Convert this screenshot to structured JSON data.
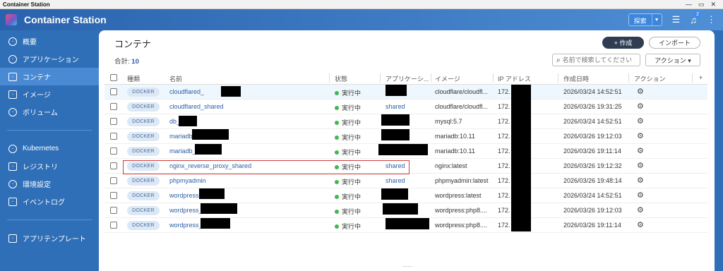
{
  "window": {
    "title": "Container Station"
  },
  "app": {
    "name": "Container Station",
    "search_label": "探索",
    "notif_count": "2"
  },
  "sidebar": {
    "groups": [
      [
        {
          "label": "概要",
          "icon": "dashboard-icon"
        },
        {
          "label": "アプリケーション",
          "icon": "apps-icon"
        },
        {
          "label": "コンテナ",
          "icon": "cube-icon",
          "active": true
        },
        {
          "label": "イメージ",
          "icon": "layers-icon"
        },
        {
          "label": "ボリューム",
          "icon": "database-icon"
        }
      ],
      [
        {
          "label": "Kubernetes",
          "icon": "kubernetes-icon"
        },
        {
          "label": "レジストリ",
          "icon": "registry-icon"
        },
        {
          "label": "環境設定",
          "icon": "gear-icon"
        },
        {
          "label": "イベントログ",
          "icon": "log-icon"
        }
      ],
      [
        {
          "label": "アプリテンプレート",
          "icon": "template-icon"
        }
      ]
    ]
  },
  "main": {
    "title": "コンテナ",
    "total_label": "合計:",
    "total_count": "10",
    "create_label": "+ 作成",
    "import_label": "インポート",
    "search_placeholder": "名前で検索してください",
    "action_label": "アクション ▾"
  },
  "table": {
    "headers": {
      "type": "種類",
      "name": "名前",
      "status": "状態",
      "app": "アプリケーシ...",
      "image": "イメージ",
      "ip": "IP アドレス",
      "created": "作成日時",
      "action": "アクション",
      "add": "+"
    },
    "rows": [
      {
        "type": "DOCKER",
        "name": "cloudflared_",
        "status": "実行中",
        "app": "",
        "image": "cloudflare/cloudfl...",
        "ip": "172.",
        "created": "2026/03/24 14:52:51"
      },
      {
        "type": "DOCKER",
        "name": "cloudflared_shared",
        "status": "実行中",
        "app": "shared",
        "image": "cloudflare/cloudfl...",
        "ip": "172.",
        "created": "2026/03/26 19:31:25"
      },
      {
        "type": "DOCKER",
        "name": "db_",
        "status": "実行中",
        "app": "",
        "image": "mysql:5.7",
        "ip": "172.",
        "created": "2026/03/24 14:52:51"
      },
      {
        "type": "DOCKER",
        "name": "mariadb",
        "status": "実行中",
        "app": "",
        "image": "mariadb:10.11",
        "ip": "172.",
        "created": "2026/03/26 19:12:03"
      },
      {
        "type": "DOCKER",
        "name": "mariadb_",
        "status": "実行中",
        "app": "",
        "image": "mariadb:10.11",
        "ip": "172.",
        "created": "2026/03/26 19:11:14"
      },
      {
        "type": "DOCKER",
        "name": "nginx_reverse_proxy_shared",
        "status": "実行中",
        "app": "shared",
        "image": "nginx:latest",
        "ip": "172.",
        "created": "2026/03/26 19:12:32"
      },
      {
        "type": "DOCKER",
        "name": "phpmyadmin",
        "status": "実行中",
        "app": "shared",
        "image": "phpmyadmin:latest",
        "ip": "172.",
        "created": "2026/03/26 19:48:14"
      },
      {
        "type": "DOCKER",
        "name": "wordpress",
        "status": "実行中",
        "app": "",
        "image": "wordpress:latest",
        "ip": "172.",
        "created": "2026/03/24 14:52:51"
      },
      {
        "type": "DOCKER",
        "name": "wordpress_",
        "status": "実行中",
        "app": "",
        "image": "wordpress:php8....",
        "ip": "172.",
        "created": "2026/03/26 19:12:03"
      },
      {
        "type": "DOCKER",
        "name": "wordpress_",
        "status": "実行中",
        "app": "",
        "image": "wordpress:php8....",
        "ip": "172.",
        "created": "2026/03/26 19:11:14"
      }
    ]
  },
  "colors": {
    "accent": "#2f6fb8",
    "running": "#3fb950",
    "link": "#2b5ea6",
    "highlight": "#d23a3a"
  }
}
